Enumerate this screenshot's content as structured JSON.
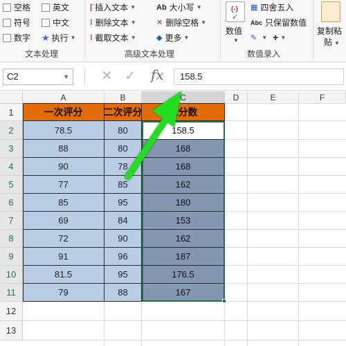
{
  "ribbon": {
    "col1": {
      "r1": "空格",
      "r2": "符号",
      "r3": "数字"
    },
    "col2": {
      "r1": "英文",
      "r2": "中文",
      "r3": "执行"
    },
    "group1_label": "文本处理",
    "col3": {
      "r1": "插入文本",
      "r2": "删除文本",
      "r3": "截取文本"
    },
    "col4": {
      "r1": "大小写",
      "r2": "删除空格",
      "r3": "更多"
    },
    "group2_label": "高级文本处理",
    "col5_big": "数值",
    "col6": {
      "r1": "四舍五入",
      "r2": "只保留数值",
      "r3": "+"
    },
    "group3_label": "数值录入",
    "col7_big_line1": "复制粘",
    "col7_big_line2": "贴"
  },
  "formula_bar": {
    "name_box": "C2",
    "cancel_glyph": "✕",
    "enter_glyph": "✓",
    "fx_label": "fx",
    "formula_value": "158.5"
  },
  "columns": [
    "A",
    "B",
    "C",
    "D",
    "E",
    "F"
  ],
  "rows": [
    "1",
    "2",
    "3",
    "4",
    "5",
    "6",
    "7",
    "8",
    "9",
    "10",
    "11",
    "12",
    "13"
  ],
  "table": {
    "headers": [
      "一次评分",
      "二次评分",
      "总分数"
    ],
    "data": [
      [
        "78.5",
        "80",
        "158.5"
      ],
      [
        "88",
        "80",
        "168"
      ],
      [
        "90",
        "78",
        "168"
      ],
      [
        "77",
        "85",
        "162"
      ],
      [
        "85",
        "95",
        "180"
      ],
      [
        "69",
        "84",
        "153"
      ],
      [
        "72",
        "90",
        "162"
      ],
      [
        "91",
        "96",
        "187"
      ],
      [
        "81.5",
        "95",
        "176.5"
      ],
      [
        "79",
        "88",
        "167"
      ]
    ]
  },
  "colors": {
    "header_fill": "#e36c09",
    "ab_fill": "#b8cce4",
    "c_fill": "#8496b0",
    "arrow": "#22dd22",
    "selection": "#217346"
  }
}
